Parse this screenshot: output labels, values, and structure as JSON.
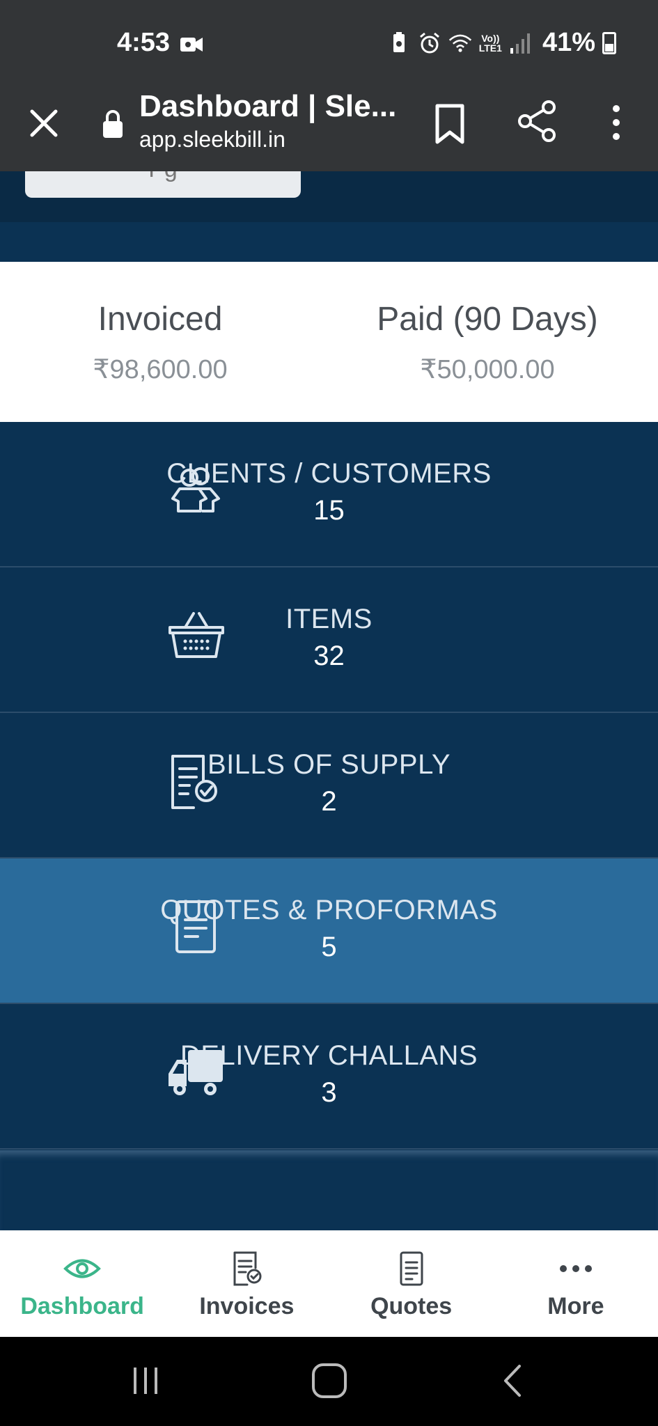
{
  "status_bar": {
    "time": "4:53",
    "lte": "Vo))\nLTE1",
    "battery": "41%"
  },
  "browser": {
    "title": "Dashboard | Sle...",
    "url": "app.sleekbill.in"
  },
  "partial_button_label": "Pg",
  "stats": {
    "invoiced_label": "Invoiced",
    "invoiced_value": "₹98,600.00",
    "paid_label": "Paid (90 Days)",
    "paid_value": "₹50,000.00"
  },
  "rows": [
    {
      "label": "CLIENTS / CUSTOMERS",
      "count": "15",
      "icon": "users-icon"
    },
    {
      "label": "ITEMS",
      "count": "32",
      "icon": "basket-icon"
    },
    {
      "label": "BILLS OF SUPPLY",
      "count": "2",
      "icon": "document-check-icon"
    },
    {
      "label": "QUOTES & PROFORMAS",
      "count": "5",
      "icon": "document-icon"
    },
    {
      "label": "DELIVERY CHALLANS",
      "count": "3",
      "icon": "truck-icon"
    }
  ],
  "bottom_nav": {
    "dashboard": "Dashboard",
    "invoices": "Invoices",
    "quotes": "Quotes",
    "more": "More"
  },
  "colors": {
    "accent": "#3bb58a",
    "dark_bg": "#0b3253",
    "active_row": "#2a6b9b",
    "browser_bar": "#333537"
  }
}
